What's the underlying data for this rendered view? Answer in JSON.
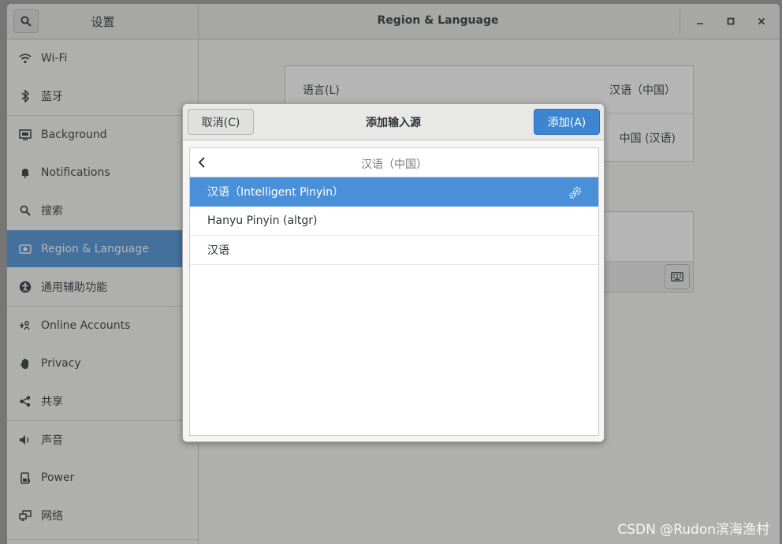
{
  "window": {
    "sidebar_title": "设置",
    "title": "Region & Language",
    "controls": {
      "minimize": "—",
      "maximize": "□",
      "close": "✕"
    }
  },
  "sidebar": {
    "items": [
      {
        "label": "Wi-Fi",
        "icon": "wifi-icon"
      },
      {
        "label": "蓝牙",
        "icon": "bluetooth-icon"
      },
      {
        "label": "Background",
        "icon": "background-icon"
      },
      {
        "label": "Notifications",
        "icon": "bell-icon"
      },
      {
        "label": "搜索",
        "icon": "search-icon"
      },
      {
        "label": "Region & Language",
        "icon": "region-icon",
        "active": true
      },
      {
        "label": "通用辅助功能",
        "icon": "accessibility-icon"
      },
      {
        "label": "Online Accounts",
        "icon": "online-accounts-icon"
      },
      {
        "label": "Privacy",
        "icon": "privacy-hand-icon"
      },
      {
        "label": "共享",
        "icon": "share-icon"
      },
      {
        "label": "声音",
        "icon": "sound-icon"
      },
      {
        "label": "Power",
        "icon": "power-icon"
      },
      {
        "label": "网络",
        "icon": "network-icon"
      }
    ]
  },
  "main": {
    "language_label": "语言(L)",
    "language_value": "汉语（中国）",
    "formats_value": "中国 (汉语)"
  },
  "dialog": {
    "cancel_label": "取消(C)",
    "title": "添加输入源",
    "add_label": "添加(A)",
    "list_header": "汉语（中国）",
    "rows": [
      {
        "label": "汉语（Intelligent Pinyin）",
        "selected": true,
        "has_settings": true
      },
      {
        "label": "Hanyu Pinyin (altgr)",
        "selected": false
      },
      {
        "label": "汉语",
        "selected": false
      }
    ]
  },
  "watermark": "CSDN @Rudon滨海渔村",
  "colors": {
    "accent": "#4a90d9",
    "add_button": "#3d85d0"
  }
}
